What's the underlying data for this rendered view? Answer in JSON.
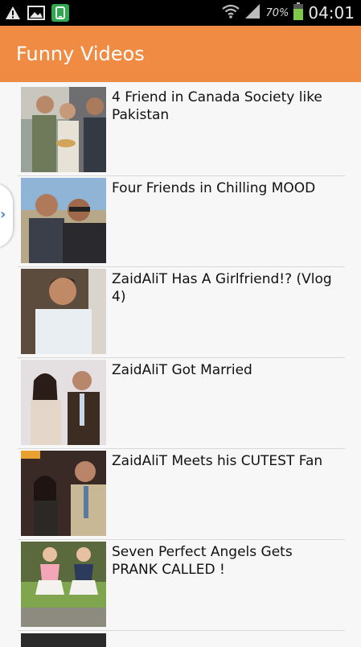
{
  "status_bar": {
    "battery_percent": "70%",
    "time": "04:01",
    "icons": [
      "warning-icon",
      "image-icon",
      "app-icon",
      "wifi-icon",
      "signal-icon",
      "battery-icon"
    ]
  },
  "app_bar": {
    "title": "Funny Videos",
    "color": "#f08b43"
  },
  "drawer_handle": {
    "glyph": "›"
  },
  "videos": [
    {
      "title": "4 Friend in Canada Society like Pakistan"
    },
    {
      "title": "Four Friends in Chilling MOOD"
    },
    {
      "title": "ZaidAliT Has A Girlfriend!? (Vlog 4)"
    },
    {
      "title": "ZaidAliT Got Married"
    },
    {
      "title": "ZaidAliT Meets his CUTEST Fan"
    },
    {
      "title": "Seven Perfect Angels Gets PRANK CALLED !"
    }
  ]
}
